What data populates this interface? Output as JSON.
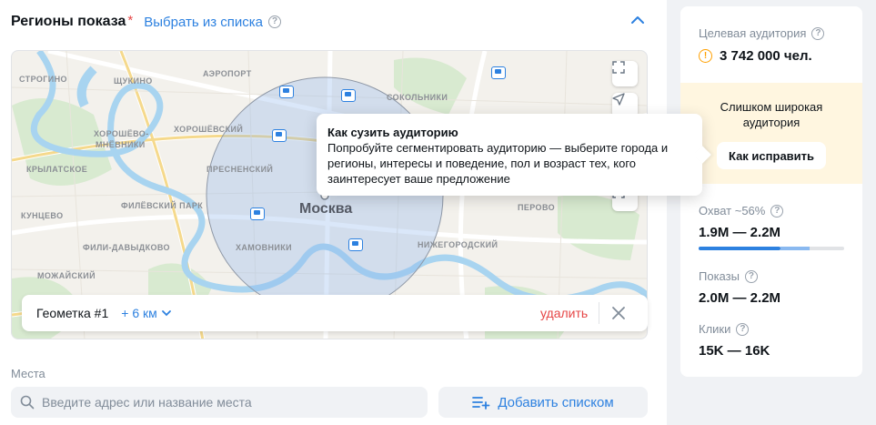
{
  "section": {
    "title": "Регионы показа",
    "required_mark": "*",
    "select_link": "Выбрать из списка"
  },
  "map": {
    "city": "Москва",
    "labels": [
      {
        "text": "СТРОГИНО",
        "name": "map-label-strogino"
      },
      {
        "text": "ЩУКИНО",
        "name": "map-label-shchukino"
      },
      {
        "text": "АЭРОПОРТ",
        "name": "map-label-aeroport"
      },
      {
        "text": "ХОРОШЁВСКИЙ",
        "name": "map-label-khoroshevsky"
      },
      {
        "text": "ХОРОШЁВО-",
        "name": "map-label-khoroshevo"
      },
      {
        "text": "МНЁВНИКИ",
        "name": "map-label-mnevniki"
      },
      {
        "text": "КРЫЛАТСКОЕ",
        "name": "map-label-krylatskoe"
      },
      {
        "text": "ПРЕСНЕНСКИЙ",
        "name": "map-label-presnensky"
      },
      {
        "text": "ФИЛЁВСКИЙ ПАРК",
        "name": "map-label-filevsky-park"
      },
      {
        "text": "КУНЦЕВО",
        "name": "map-label-kuntsevo"
      },
      {
        "text": "ФИЛИ-ДАВЫДКОВО",
        "name": "map-label-fili-davydkovo"
      },
      {
        "text": "ХАМОВНИКИ",
        "name": "map-label-khamovniki"
      },
      {
        "text": "МОЖАЙСКИЙ",
        "name": "map-label-mozhaysky"
      },
      {
        "text": "СОКОЛЬНИКИ",
        "name": "map-label-sokolniki"
      },
      {
        "text": "ПЕРОВО",
        "name": "map-label-perovo"
      },
      {
        "text": "НИЖЕГОРОДСКИЙ",
        "name": "map-label-nizhegorodsky"
      }
    ]
  },
  "geometry": {
    "name": "Геометка #1",
    "radius": "+ 6 км",
    "delete_label": "удалить"
  },
  "places": {
    "label": "Места",
    "search_placeholder": "Введите адрес или название места",
    "add_list_label": "Добавить списком"
  },
  "tooltip": {
    "title": "Как сузить аудиторию",
    "body": "Попробуйте сегментировать аудиторию — выберите города и регионы, интересы и поведение, пол и возраст тех, кого заинтересует ваше предложение"
  },
  "stats": {
    "audience_label": "Целевая аудитория",
    "audience_value": "3 742 000 чел.",
    "warning_text": "Слишком широкая аудитория",
    "fix_button": "Как исправить",
    "reach_label": "Охват ~56%",
    "reach_value": "1.9M — 2.2M",
    "reach_fraction_low": 0.56,
    "reach_fraction_high": 0.76,
    "impressions_label": "Показы",
    "impressions_value": "2.0M — 2.2M",
    "clicks_label": "Клики",
    "clicks_value": "15K — 16K"
  },
  "colors": {
    "accent": "#2d81e0",
    "danger": "#e64646",
    "warning": "#ffa000",
    "warning_bg": "#fff6e0"
  },
  "icons": [
    "help-icon",
    "chevron-up-icon",
    "expand-icon",
    "geolocation-icon",
    "ruler-icon",
    "metro-icon",
    "chevron-down-icon",
    "close-icon",
    "search-icon",
    "add-list-icon",
    "warning-icon"
  ]
}
